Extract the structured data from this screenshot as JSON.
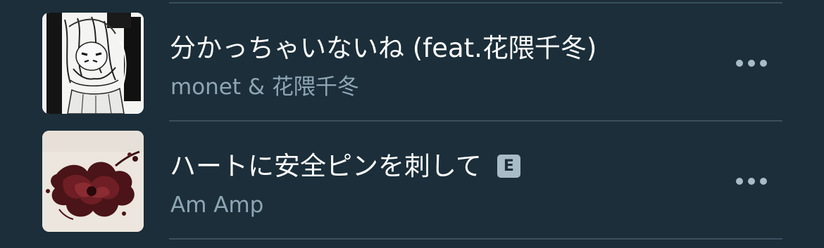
{
  "songs": [
    {
      "title": "分かっちゃいないね (feat.花隈千冬)",
      "artist": "monet & 花隈千冬",
      "explicit": false,
      "explicit_label": "",
      "artwork": "monochrome-manga-girl-artwork",
      "more_icon": "ellipsis-icon"
    },
    {
      "title": "ハートに安全ピンを刺して",
      "artist": "Am Amp",
      "explicit": true,
      "explicit_label": "E",
      "artwork": "dark-red-flower-artwork",
      "more_icon": "ellipsis-icon"
    }
  ],
  "colors": {
    "background": "#1b2e39",
    "title_text": "#ffffff",
    "artist_text": "#8ea6b3",
    "divider": "#3a4f5c",
    "icon": "#a8bcc7"
  }
}
